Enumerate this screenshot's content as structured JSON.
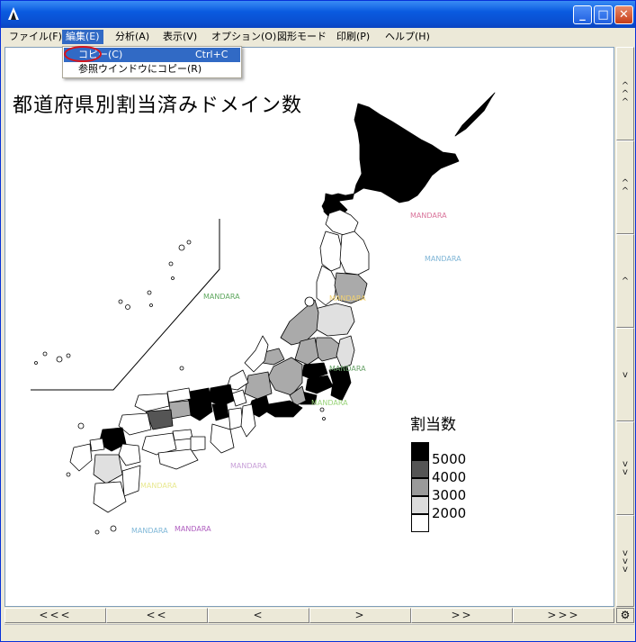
{
  "menu": {
    "file": "ファイル(F)",
    "edit": "編集(E)",
    "analysis": "分析(A)",
    "view": "表示(V)",
    "options": "オプション(O)",
    "shape_mode": "図形モード",
    "print": "印刷(P)",
    "help": "ヘルプ(H)"
  },
  "edit_menu": {
    "copy_label": "コピー(C)",
    "copy_shortcut": "Ctrl+C",
    "copy_to_ref_label": "参照ウインドウにコピー(R)"
  },
  "map": {
    "title": "都道府県別割当済みドメイン数",
    "watermark_text": "MANDARA",
    "watermark_colors": [
      "#d9739a",
      "#7fb5d6",
      "#5fa85f",
      "#f0d070",
      "#6aa36a",
      "#9ad47a",
      "#c8a0d8",
      "#e8e890",
      "#80b8d8",
      "#b060c0"
    ]
  },
  "legend": {
    "title": "割当数",
    "items": [
      {
        "label": "5000",
        "color": "#000000"
      },
      {
        "label": "4000",
        "color": "#555555"
      },
      {
        "label": "3000",
        "color": "#9a9a9a"
      },
      {
        "label": "2000",
        "color": "#dcdcdc"
      },
      {
        "label": "",
        "color": "#ffffff"
      }
    ]
  },
  "vscroll": {
    "buttons": [
      "^\n^\n^",
      "^\n^",
      "^",
      "v",
      "v\nv",
      "v\nv\nv"
    ]
  },
  "hscroll": {
    "buttons": [
      "<<<",
      "<<",
      "<",
      ">",
      ">>",
      ">>>"
    ]
  },
  "icons": {
    "app": "mandara-app-icon",
    "minimize": "minimize-icon",
    "maximize": "maximize-icon",
    "close": "close-icon",
    "settings": "gear-icon"
  }
}
